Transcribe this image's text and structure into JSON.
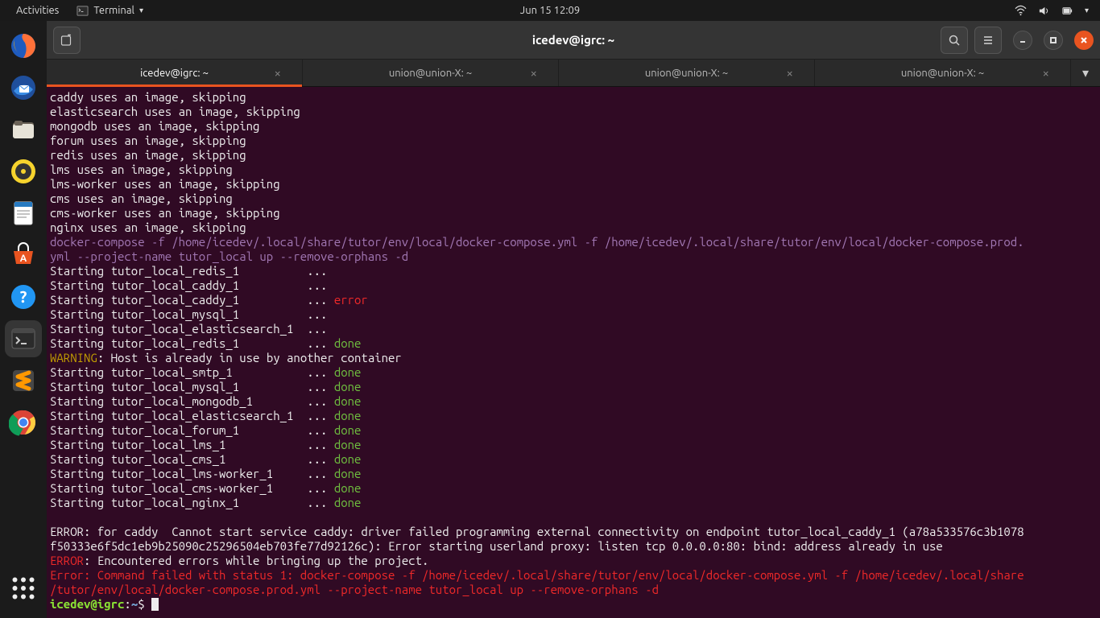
{
  "topbar": {
    "activities": "Activities",
    "app_label": "Terminal",
    "clock": "Jun 15  12:09"
  },
  "dock": {
    "items": [
      "firefox",
      "thunderbird",
      "files",
      "rhythmbox",
      "writer",
      "software",
      "help",
      "terminal",
      "sublime",
      "chrome"
    ]
  },
  "window": {
    "title": "icedev@igrc: ~"
  },
  "tabs": [
    {
      "label": "icedev@igrc: ~",
      "active": true
    },
    {
      "label": "union@union-X: ~",
      "active": false
    },
    {
      "label": "union@union-X: ~",
      "active": false
    },
    {
      "label": "union@union-X: ~",
      "active": false
    }
  ],
  "prompt": {
    "userhost": "icedev@igrc",
    "sep": ":",
    "path": "~",
    "suffix": "$ "
  },
  "lines": [
    {
      "t": "plain",
      "text": "caddy uses an image, skipping"
    },
    {
      "t": "plain",
      "text": "elasticsearch uses an image, skipping"
    },
    {
      "t": "plain",
      "text": "mongodb uses an image, skipping"
    },
    {
      "t": "plain",
      "text": "forum uses an image, skipping"
    },
    {
      "t": "plain",
      "text": "redis uses an image, skipping"
    },
    {
      "t": "plain",
      "text": "lms uses an image, skipping"
    },
    {
      "t": "plain",
      "text": "lms-worker uses an image, skipping"
    },
    {
      "t": "plain",
      "text": "cms uses an image, skipping"
    },
    {
      "t": "plain",
      "text": "cms-worker uses an image, skipping"
    },
    {
      "t": "plain",
      "text": "nginx uses an image, skipping"
    },
    {
      "t": "purple",
      "text": "docker-compose -f /home/icedev/.local/share/tutor/env/local/docker-compose.yml -f /home/icedev/.local/share/tutor/env/local/docker-compose.prod.yml --project-name tutor_local up --remove-orphans -d"
    },
    {
      "t": "start",
      "name": "tutor_local_redis_1",
      "dots": true,
      "status": null
    },
    {
      "t": "start",
      "name": "tutor_local_caddy_1",
      "dots": true,
      "status": null
    },
    {
      "t": "start",
      "name": "tutor_local_caddy_1",
      "dots": false,
      "status": "error"
    },
    {
      "t": "start",
      "name": "tutor_local_mysql_1",
      "dots": true,
      "status": null
    },
    {
      "t": "start",
      "name": "tutor_local_elasticsearch_1",
      "dots": true,
      "status": null
    },
    {
      "t": "start",
      "name": "tutor_local_redis_1",
      "dots": false,
      "status": "done"
    },
    {
      "t": "warn",
      "text": ": Host is already in use by another container"
    },
    {
      "t": "start",
      "name": "tutor_local_smtp_1",
      "dots": false,
      "status": "done"
    },
    {
      "t": "start",
      "name": "tutor_local_mysql_1",
      "dots": false,
      "status": "done"
    },
    {
      "t": "start",
      "name": "tutor_local_mongodb_1",
      "dots": false,
      "status": "done"
    },
    {
      "t": "start",
      "name": "tutor_local_elasticsearch_1",
      "dots": false,
      "status": "done"
    },
    {
      "t": "start",
      "name": "tutor_local_forum_1",
      "dots": false,
      "status": "done"
    },
    {
      "t": "start",
      "name": "tutor_local_lms_1",
      "dots": false,
      "status": "done"
    },
    {
      "t": "start",
      "name": "tutor_local_cms_1",
      "dots": false,
      "status": "done"
    },
    {
      "t": "start",
      "name": "tutor_local_lms-worker_1",
      "dots": false,
      "status": "done"
    },
    {
      "t": "start",
      "name": "tutor_local_cms-worker_1",
      "dots": false,
      "status": "done"
    },
    {
      "t": "start",
      "name": "tutor_local_nginx_1",
      "dots": false,
      "status": "done"
    },
    {
      "t": "blank"
    },
    {
      "t": "plain",
      "text": "ERROR: for caddy  Cannot start service caddy: driver failed programming external connectivity on endpoint tutor_local_caddy_1 (a78a533576c3b1078f50333e6f5dc1eb9b25090c25296504eb703fe77d92126c): Error starting userland proxy: listen tcp 0.0.0.0:80: bind: address already in use"
    },
    {
      "t": "err",
      "label": "ERROR",
      "text": ": Encountered errors while bringing up the project."
    },
    {
      "t": "errline",
      "text": "Error: Command failed with status 1: docker-compose -f /home/icedev/.local/share/tutor/env/local/docker-compose.yml -f /home/icedev/.local/share/tutor/env/local/docker-compose.prod.yml --project-name tutor_local up --remove-orphans -d"
    }
  ]
}
